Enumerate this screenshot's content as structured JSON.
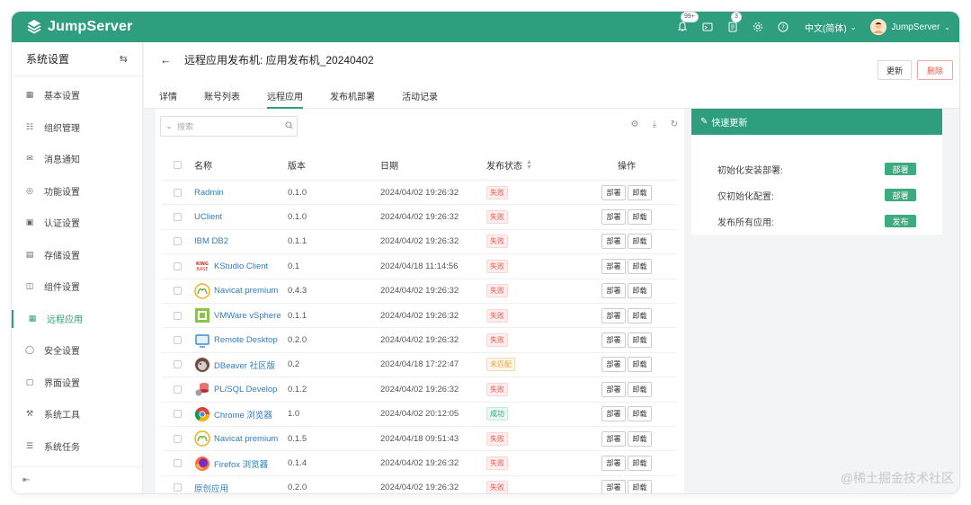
{
  "header": {
    "brand": "JumpServer",
    "badges": {
      "messages": "99+",
      "tickets": "3"
    },
    "language": "中文(简体)",
    "user": "JumpServer",
    "accent": "#2f9e7e"
  },
  "sidebar": {
    "title": "系统设置",
    "items": [
      {
        "label": "基本设置",
        "icon": "grid-icon"
      },
      {
        "label": "组织管理",
        "icon": "org-icon"
      },
      {
        "label": "消息通知",
        "icon": "message-icon"
      },
      {
        "label": "功能设置",
        "icon": "feature-icon"
      },
      {
        "label": "认证设置",
        "icon": "auth-icon"
      },
      {
        "label": "存储设置",
        "icon": "storage-icon"
      },
      {
        "label": "组件设置",
        "icon": "component-icon"
      },
      {
        "label": "远程应用",
        "icon": "apps-icon"
      },
      {
        "label": "安全设置",
        "icon": "shield-icon"
      },
      {
        "label": "界面设置",
        "icon": "interface-icon"
      },
      {
        "label": "系统工具",
        "icon": "tools-icon"
      },
      {
        "label": "系统任务",
        "icon": "tasks-icon"
      }
    ]
  },
  "page": {
    "title": "远程应用发布机: 应用发布机_20240402",
    "update_label": "更新",
    "delete_label": "删除",
    "tabs": [
      "详情",
      "账号列表",
      "远程应用",
      "发布机部署",
      "活动记录"
    ]
  },
  "table": {
    "search_placeholder": "搜索",
    "columns": [
      "名称",
      "版本",
      "日期",
      "发布状态",
      "操作"
    ],
    "deploy_label": "部署",
    "uninstall_label": "卸载",
    "rows": [
      {
        "name": "Radmin",
        "icon": "",
        "version": "0.1.0",
        "date": "2024/04/02 19:26:32",
        "status": "失败",
        "kind": "fail"
      },
      {
        "name": "UClient",
        "icon": "",
        "version": "0.1.0",
        "date": "2024/04/02 19:26:32",
        "status": "失败",
        "kind": "fail"
      },
      {
        "name": "IBM DB2",
        "icon": "",
        "version": "0.1.1",
        "date": "2024/04/02 19:26:32",
        "status": "失败",
        "kind": "fail"
      },
      {
        "name": "KStudio Client",
        "icon": "kingbase-icon",
        "version": "0.1",
        "date": "2024/04/18 11:14:56",
        "status": "失败",
        "kind": "fail"
      },
      {
        "name": "Navicat premium",
        "icon": "navicat-icon",
        "version": "0.4.3",
        "date": "2024/04/02 19:26:32",
        "status": "失败",
        "kind": "fail"
      },
      {
        "name": "VMWare vSphere",
        "icon": "vmware-icon",
        "version": "0.1.1",
        "date": "2024/04/02 19:26:32",
        "status": "失败",
        "kind": "fail"
      },
      {
        "name": "Remote Desktop",
        "icon": "monitor-icon",
        "version": "0.2.0",
        "date": "2024/04/02 19:26:32",
        "status": "失败",
        "kind": "fail"
      },
      {
        "name": "DBeaver 社区版",
        "icon": "dbeaver-icon",
        "version": "0.2",
        "date": "2024/04/18 17:22:47",
        "status": "未匹配",
        "kind": "warn"
      },
      {
        "name": "PL/SQL Develop",
        "icon": "plsql-icon",
        "version": "0.1.2",
        "date": "2024/04/02 19:26:32",
        "status": "失败",
        "kind": "fail"
      },
      {
        "name": "Chrome 浏览器",
        "icon": "chrome-icon",
        "version": "1.0",
        "date": "2024/04/02 20:12:05",
        "status": "成功",
        "kind": "ok"
      },
      {
        "name": "Navicat premium",
        "icon": "navicat-icon",
        "version": "0.1.5",
        "date": "2024/04/18 09:51:43",
        "status": "失败",
        "kind": "fail"
      },
      {
        "name": "Firefox 浏览器",
        "icon": "firefox-icon",
        "version": "0.1.4",
        "date": "2024/04/02 19:26:32",
        "status": "失败",
        "kind": "fail"
      },
      {
        "name": "原创应用",
        "icon": "",
        "version": "0.2.0",
        "date": "2024/04/02 19:26:32",
        "status": "失败",
        "kind": "fail"
      }
    ]
  },
  "quick_update": {
    "title": "快速更新",
    "items": [
      {
        "label": "初始化安装部署:",
        "action": "部署"
      },
      {
        "label": "仅初始化配置:",
        "action": "部署"
      },
      {
        "label": "发布所有应用:",
        "action": "发布"
      }
    ]
  },
  "watermark": "@稀土掘金技术社区"
}
